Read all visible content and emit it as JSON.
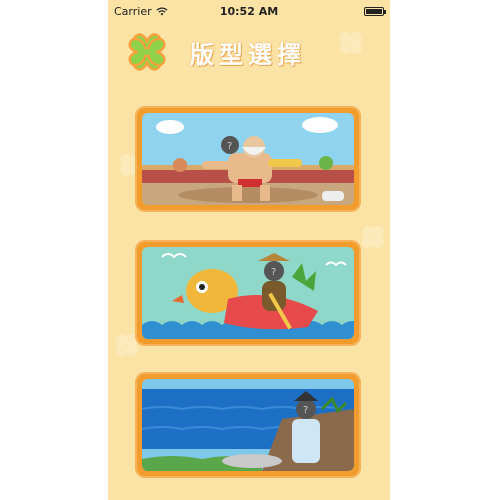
{
  "status_bar": {
    "carrier": "Carrier",
    "time": "10:52 AM"
  },
  "header": {
    "title": "版型選擇"
  },
  "templates": [
    {
      "id": "wrestler",
      "icon": "wrestler-scene-image"
    },
    {
      "id": "dragon-boat",
      "icon": "dragon-boat-scene-image"
    },
    {
      "id": "seaside-poet",
      "icon": "seaside-poet-scene-image"
    }
  ],
  "colors": {
    "background": "#fbe3a6",
    "card_border": "#f39c2e",
    "title_text": "#ffffff",
    "clover": "#8fd24a"
  }
}
